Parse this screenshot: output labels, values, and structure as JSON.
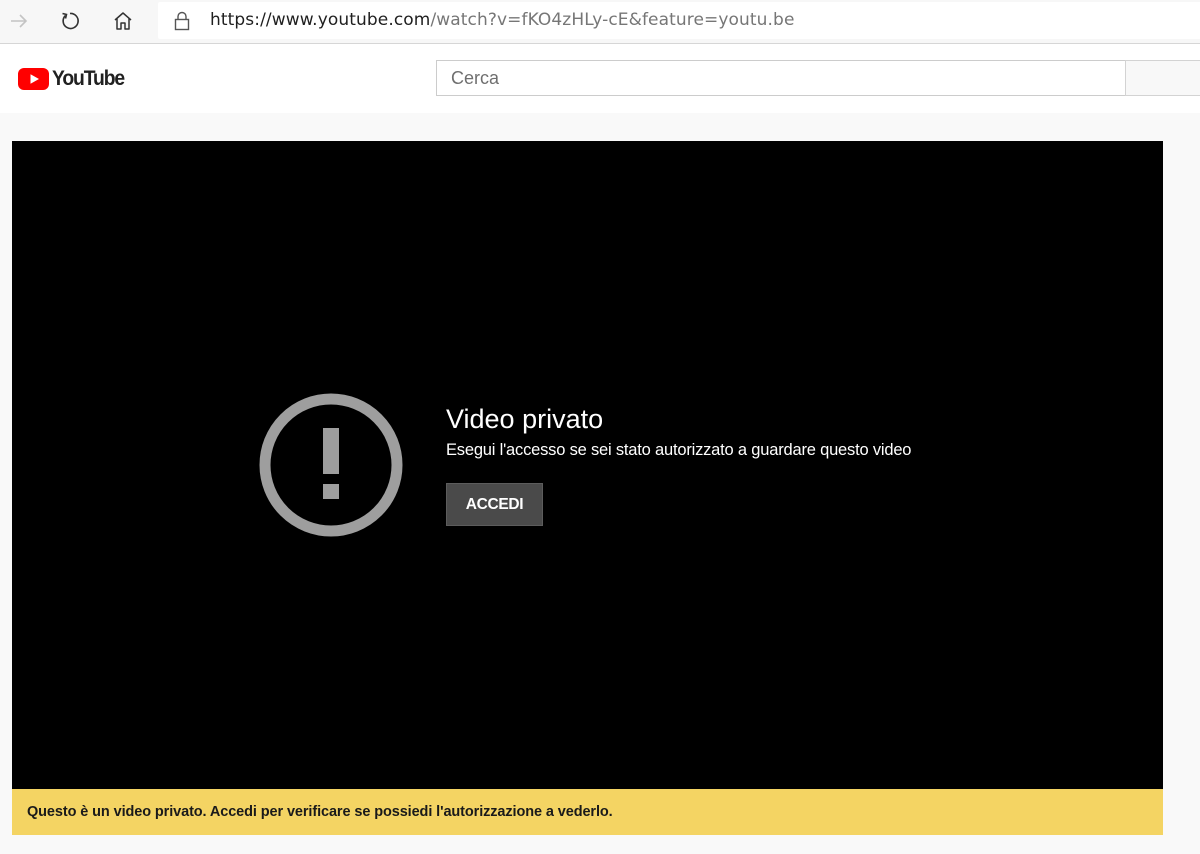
{
  "browser": {
    "url_host": "https://www.youtube.com",
    "url_path": "/watch?v=fKO4zHLy-cE&feature=youtu.be",
    "icons": [
      "forward-arrow-icon",
      "reload-icon",
      "home-icon",
      "lock-icon"
    ]
  },
  "header": {
    "logo_text": "YouTube",
    "search_placeholder": "Cerca",
    "brand_color": "#ff0000"
  },
  "player": {
    "error_title": "Video privato",
    "error_subtitle": "Esegui l'accesso se sei stato autorizzato a guardare questo video",
    "signin_label": "ACCEDI",
    "icon": "alert-circle-icon"
  },
  "notice": {
    "text": "Questo è un video privato. Accedi per verificare se possiedi l'autorizzazione a vederlo.",
    "color": "#f4d463"
  }
}
